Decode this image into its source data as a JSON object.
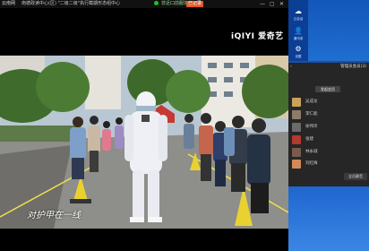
{
  "titlebar": {
    "app": "云南网",
    "title": "南德政读中心(区) \"二级二级\"执行截期形态组中心",
    "status": "非近口前服协议运算",
    "action": "已记录",
    "minimize": "—",
    "restore": "▢",
    "close": "✕"
  },
  "video": {
    "watermark": "iQIYI 爱奇艺",
    "subtitle": "对护甲在一线"
  },
  "sidebar": {
    "rail": [
      {
        "icon": "cloud-icon",
        "glyph": "☁",
        "label": "云会话"
      },
      {
        "icon": "user-icon",
        "glyph": "👤",
        "label": "通讯录"
      },
      {
        "icon": "settings-icon",
        "glyph": "⚙",
        "label": "设置"
      }
    ],
    "panel": {
      "arrow": "‹",
      "room": "管理员会员(3)",
      "button": "发起会员",
      "contacts": [
        {
          "name": "吴成龙",
          "color": "#c9a25a"
        },
        {
          "name": "李仁能",
          "color": "#8c7d6a"
        },
        {
          "name": "徐伟玲",
          "color": "#6b6b6b"
        },
        {
          "name": "张建",
          "color": "#b33a2e"
        },
        {
          "name": "林永城",
          "color": "#7a5a4a"
        },
        {
          "name": "刘红梅",
          "color": "#d28a5a"
        }
      ],
      "footer": "全员静音"
    }
  }
}
